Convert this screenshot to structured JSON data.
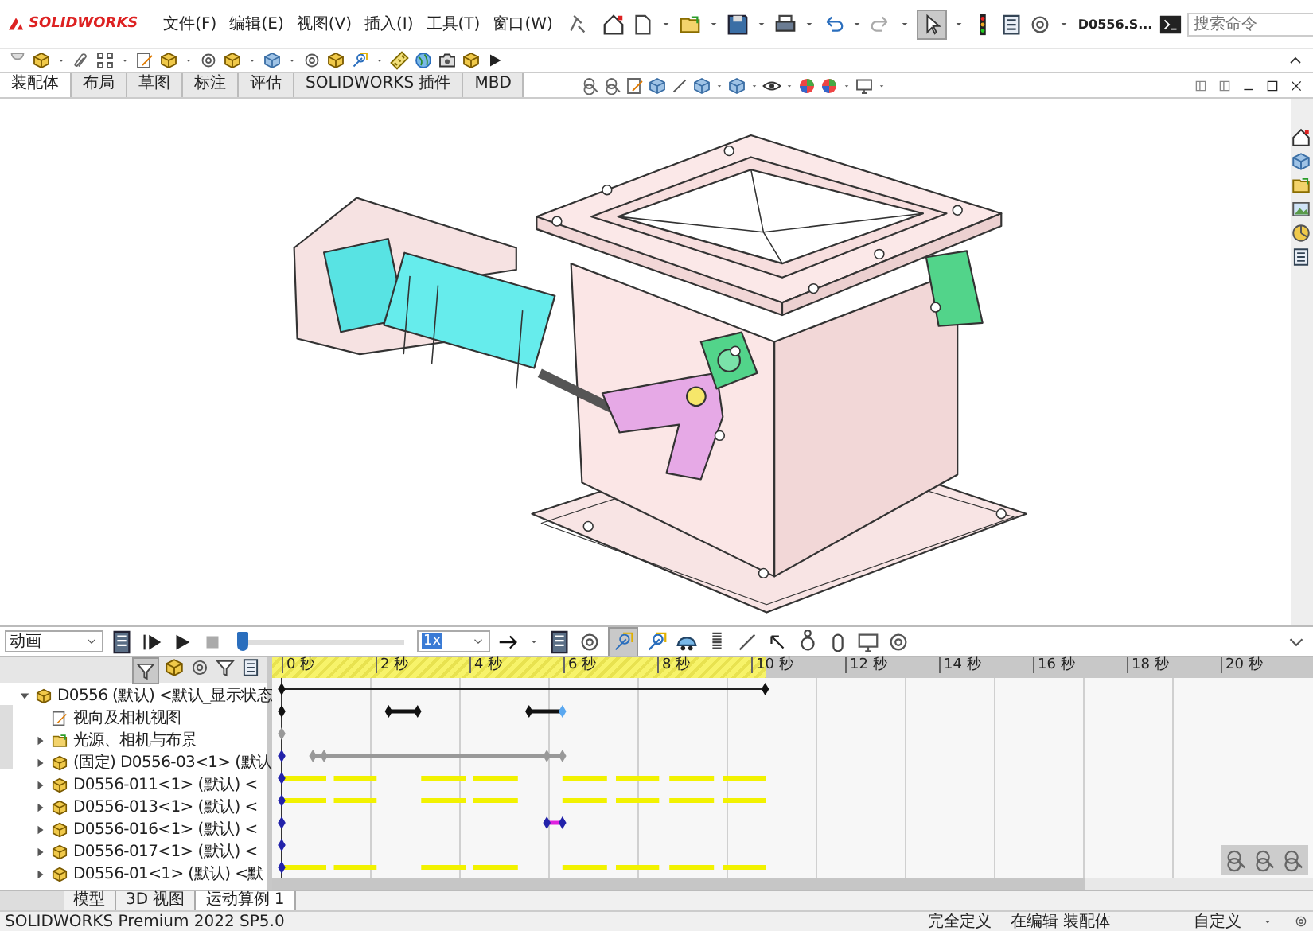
{
  "app": {
    "logo": "SOLIDWORKS"
  },
  "menu": [
    "文件(F)",
    "编辑(E)",
    "视图(V)",
    "插入(I)",
    "工具(T)",
    "窗口(W)"
  ],
  "document_title": "D0556.S...",
  "search": {
    "placeholder": "搜索命令"
  },
  "command_tabs": [
    {
      "label": "装配体",
      "selected": true
    },
    {
      "label": "布局",
      "selected": false
    },
    {
      "label": "草图",
      "selected": false
    },
    {
      "label": "标注",
      "selected": false
    },
    {
      "label": "评估",
      "selected": false
    },
    {
      "label": "SOLIDWORKS 插件",
      "selected": false
    },
    {
      "label": "MBD",
      "selected": false
    }
  ],
  "motion": {
    "study_type": "动画",
    "speed": "1x",
    "timebar": {
      "level": 0
    },
    "ruler": [
      "0 秒",
      "2 秒",
      "4 秒",
      "6 秒",
      "8 秒",
      "10 秒",
      "12 秒",
      "14 秒",
      "16 秒",
      "18 秒",
      "20 秒"
    ],
    "tree": {
      "label": "D0556 (默认) <默认_显示状态",
      "kind": "assembly",
      "expanded": true,
      "children": [
        {
          "label": "视向及相机视图",
          "kind": "camera"
        },
        {
          "label": "光源、相机与布景",
          "kind": "lights",
          "expanded": false
        },
        {
          "label": "(固定) D0556-03<1> (默认",
          "kind": "subassembly",
          "expanded": false
        },
        {
          "label": "D0556-011<1> (默认) <",
          "kind": "part",
          "expanded": false
        },
        {
          "label": "D0556-013<1> (默认) <",
          "kind": "part",
          "expanded": false
        },
        {
          "label": "D0556-016<1> (默认) <",
          "kind": "part",
          "expanded": false
        },
        {
          "label": "D0556-017<1> (默认) <",
          "kind": "part",
          "expanded": false
        },
        {
          "label": "D0556-01<1> (默认) <默",
          "kind": "subassembly",
          "expanded": false
        }
      ]
    }
  },
  "bottom_tabs": [
    {
      "label": "模型",
      "selected": false
    },
    {
      "label": "3D 视图",
      "selected": false
    },
    {
      "label": "运动算例 1",
      "selected": true
    }
  ],
  "status_bar": {
    "product": "SOLIDWORKS Premium 2022 SP5.0",
    "state": "完全定义",
    "mode": "在编辑 装配体",
    "units": "自定义"
  }
}
